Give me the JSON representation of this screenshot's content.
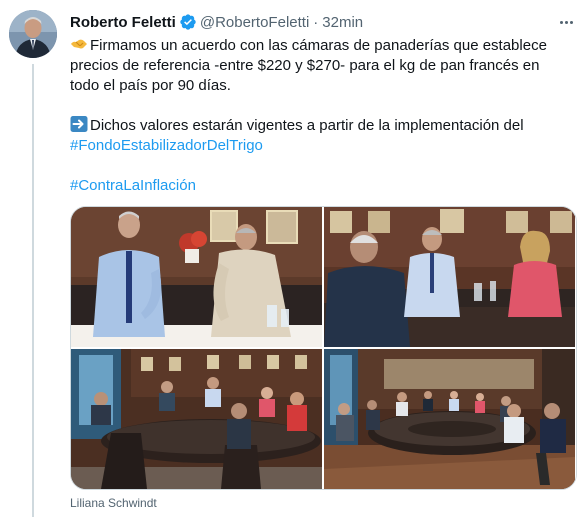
{
  "author": {
    "name": "Roberto Feletti",
    "handle": "@RobertoFeletti",
    "separator": "·",
    "time": "32min"
  },
  "tweet": {
    "line1": "Firmamos un acuerdo con las cámaras de panaderías que establece",
    "line2": "precios de referencia -entre $220 y $270- para el kg de pan francés en",
    "line3": "todo el país por 90 días.",
    "line4": "Dichos valores estarán vigentes a partir de la implementación del",
    "hashtag1": "#FondoEstabilizadorDelTrigo",
    "hashtag2": "#ContraLaInflación"
  },
  "icons": {
    "lead_emoji": "handshake-emoji",
    "arrow_emoji": "right-arrow-emoji",
    "verified": "verified-badge-icon",
    "more": "more-options-icon"
  },
  "media": {
    "photo_credit": "Liliana Schwindt"
  },
  "colors": {
    "link": "#1d9bf0",
    "secondary_text": "#536471",
    "verified": "#1d9bf0"
  }
}
